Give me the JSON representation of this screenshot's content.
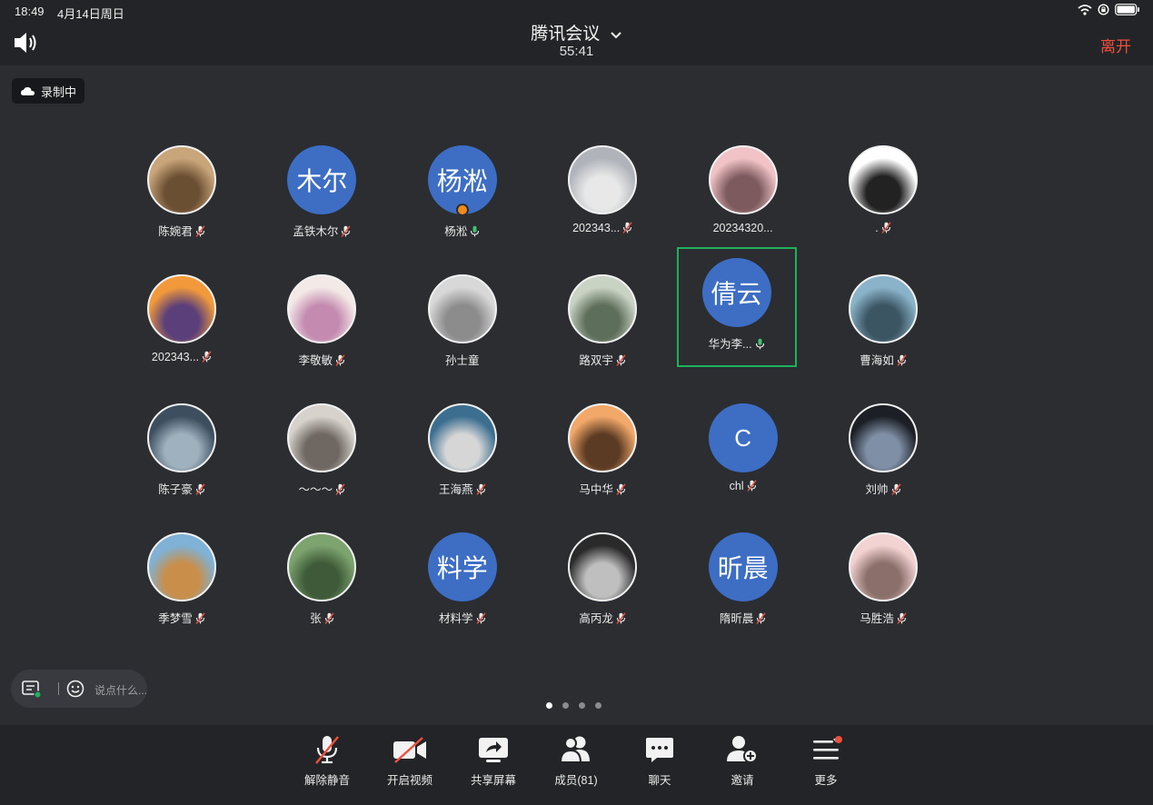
{
  "status_bar": {
    "time": "18:49",
    "date": "4月14日周日"
  },
  "header": {
    "title": "腾讯会议",
    "timer": "55:41",
    "leave_label": "离开"
  },
  "recording": {
    "label": "录制中"
  },
  "participants": [
    {
      "name": "陈婉君",
      "avatar_type": "photo",
      "mic": "off"
    },
    {
      "name": "孟铁木尔",
      "avatar_type": "text",
      "avatar_text": "木尔",
      "mic": "off"
    },
    {
      "name": "杨淞",
      "avatar_type": "text",
      "avatar_text": "杨淞",
      "mic": "on",
      "host": true
    },
    {
      "name": "202343...",
      "avatar_type": "photo",
      "mic": "off"
    },
    {
      "name": "20234320...",
      "avatar_type": "photo",
      "mic": "none"
    },
    {
      "name": ".",
      "avatar_type": "photo",
      "mic": "off"
    },
    {
      "name": "202343...",
      "avatar_type": "photo",
      "mic": "off"
    },
    {
      "name": "李敬敏",
      "avatar_type": "photo",
      "mic": "off"
    },
    {
      "name": "孙士童",
      "avatar_type": "photo",
      "mic": "none"
    },
    {
      "name": "路双宇",
      "avatar_type": "photo",
      "mic": "off"
    },
    {
      "name": "华为李...",
      "avatar_type": "text",
      "avatar_text": "倩云",
      "mic": "on",
      "active": true
    },
    {
      "name": "曹海如",
      "avatar_type": "photo",
      "mic": "off"
    },
    {
      "name": "陈子豪",
      "avatar_type": "photo",
      "mic": "off"
    },
    {
      "name": "～～～",
      "avatar_type": "photo",
      "mic": "off"
    },
    {
      "name": "王海燕",
      "avatar_type": "photo",
      "mic": "off"
    },
    {
      "name": "马中华",
      "avatar_type": "photo",
      "mic": "off"
    },
    {
      "name": "chl",
      "avatar_type": "text",
      "avatar_text": "C",
      "mic": "off"
    },
    {
      "name": "刘帅",
      "avatar_type": "photo",
      "mic": "off"
    },
    {
      "name": "季梦雪",
      "avatar_type": "photo",
      "mic": "off"
    },
    {
      "name": "张",
      "avatar_type": "photo",
      "mic": "off"
    },
    {
      "name": "材料学",
      "avatar_type": "text",
      "avatar_text": "料学",
      "mic": "off"
    },
    {
      "name": "高丙龙",
      "avatar_type": "photo",
      "mic": "off"
    },
    {
      "name": "隋昕晨",
      "avatar_type": "text",
      "avatar_text": "昕晨",
      "mic": "off"
    },
    {
      "name": "马胜浩",
      "avatar_type": "photo",
      "mic": "off"
    }
  ],
  "pager": {
    "pages": 4,
    "current": 1
  },
  "chat_input": {
    "placeholder": "说点什么..."
  },
  "toolbar": {
    "unmute_label": "解除静音",
    "video_label": "开启视频",
    "share_label": "共享屏幕",
    "members_label": "成员(81)",
    "chat_label": "聊天",
    "invite_label": "邀请",
    "more_label": "更多"
  },
  "colors": {
    "accent_blue": "#3d6ec4",
    "leave_red": "#f0503c",
    "active_green": "#1fb05c",
    "background": "#2b2d31",
    "bar": "#232427"
  },
  "icons": [
    "wifi-icon",
    "screen-lock-icon",
    "battery-icon",
    "speaker-icon",
    "chevron-down-icon",
    "cloud-icon",
    "mic-off-icon",
    "mic-on-icon",
    "chat-list-icon",
    "emoji-icon",
    "video-off-icon",
    "share-screen-icon",
    "members-icon",
    "chat-bubble-icon",
    "add-user-icon",
    "menu-icon"
  ]
}
